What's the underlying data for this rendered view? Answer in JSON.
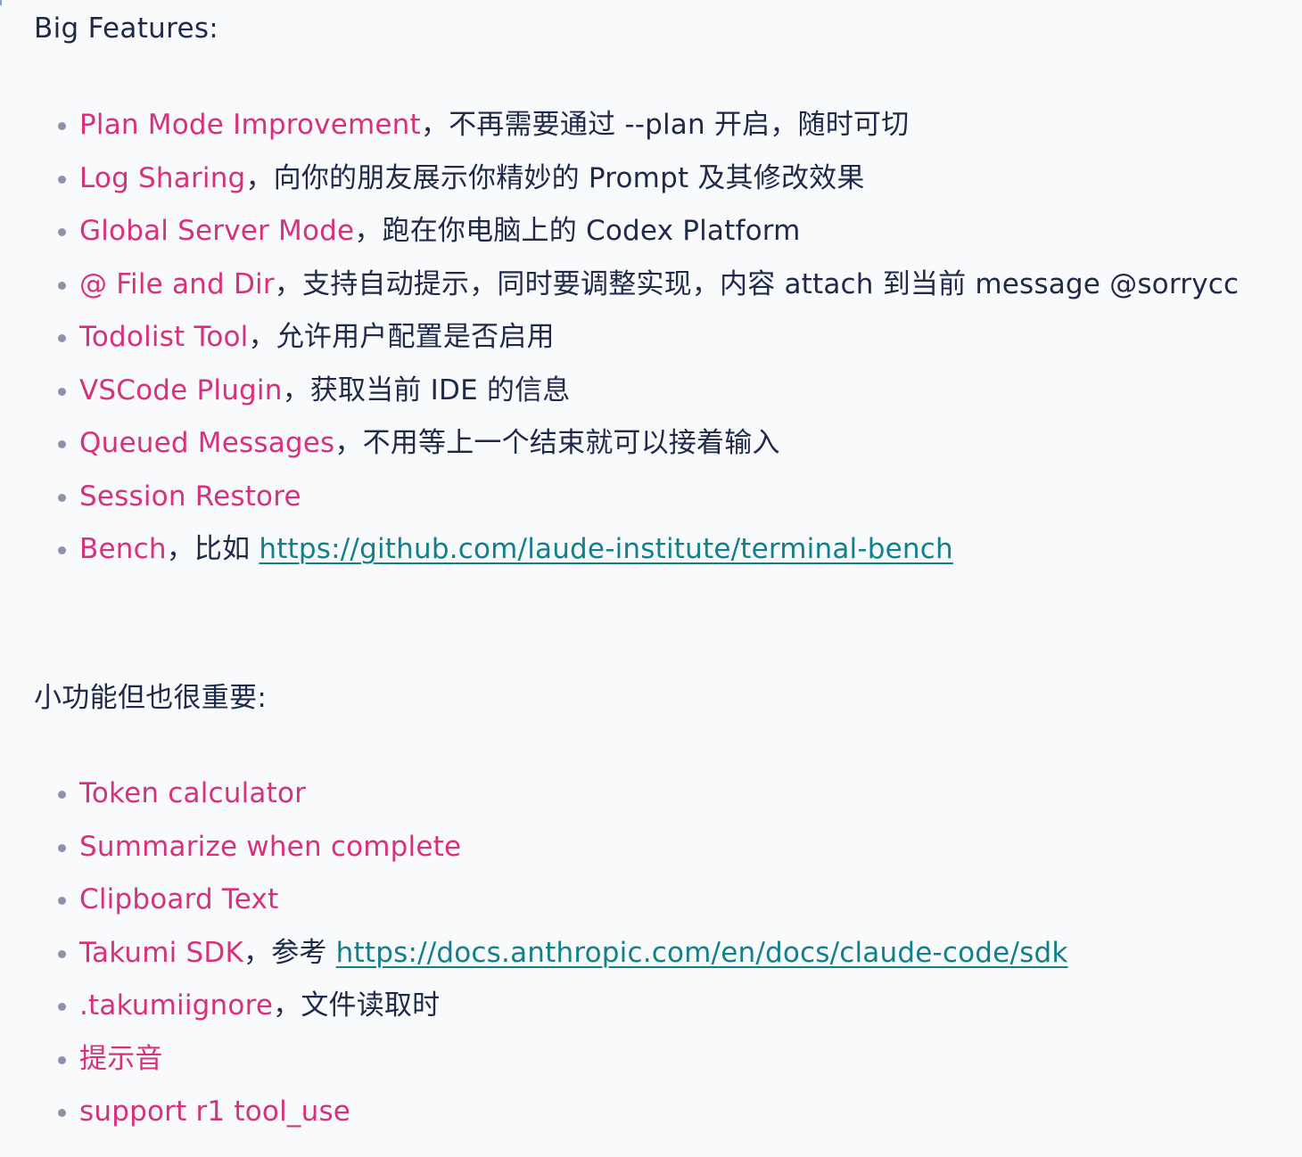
{
  "sections": [
    {
      "heading": "Big Features:",
      "items": [
        {
          "title": "Plan Mode Improvement",
          "sep": "，",
          "desc": "不再需要通过 --plan 开启，随时可切"
        },
        {
          "title": "Log Sharing",
          "sep": "，",
          "desc": "向你的朋友展示你精妙的 Prompt 及其修改效果"
        },
        {
          "title": "Global Server Mode",
          "sep": "，",
          "desc": "跑在你电脑上的 Codex Platform"
        },
        {
          "title": "@ File and Dir",
          "sep": "，",
          "desc": "支持自动提示，同时要调整实现，内容 attach 到当前 message @sorrycc"
        },
        {
          "title": "Todolist Tool",
          "sep": "，",
          "desc": "允许用户配置是否启用"
        },
        {
          "title": "VSCode Plugin",
          "sep": "，",
          "desc": "获取当前 IDE 的信息"
        },
        {
          "title": "Queued Messages",
          "sep": "，",
          "desc": "不用等上一个结束就可以接着输入"
        },
        {
          "title": "Session Restore"
        },
        {
          "title": "Bench",
          "sep": "，",
          "desc": "比如 ",
          "link": "https://github.com/laude-institute/terminal-bench"
        }
      ]
    },
    {
      "heading": "小功能但也很重要:",
      "items": [
        {
          "title": "Token calculator"
        },
        {
          "title": "Summarize when complete"
        },
        {
          "title": "Clipboard Text"
        },
        {
          "title": "Takumi SDK",
          "sep": "，",
          "desc": "参考 ",
          "link": "https://docs.anthropic.com/en/docs/claude-code/sdk"
        },
        {
          "title": ".takumiignore",
          "sep": "，",
          "desc": "文件读取时"
        },
        {
          "title": "提示音"
        },
        {
          "title": "support r1 tool_use"
        }
      ]
    }
  ],
  "colors": {
    "highlight": "#d6317d",
    "text": "#1f2a4a",
    "link": "#11808a",
    "bullet": "#8d93aa",
    "background": "#f9fafc"
  }
}
